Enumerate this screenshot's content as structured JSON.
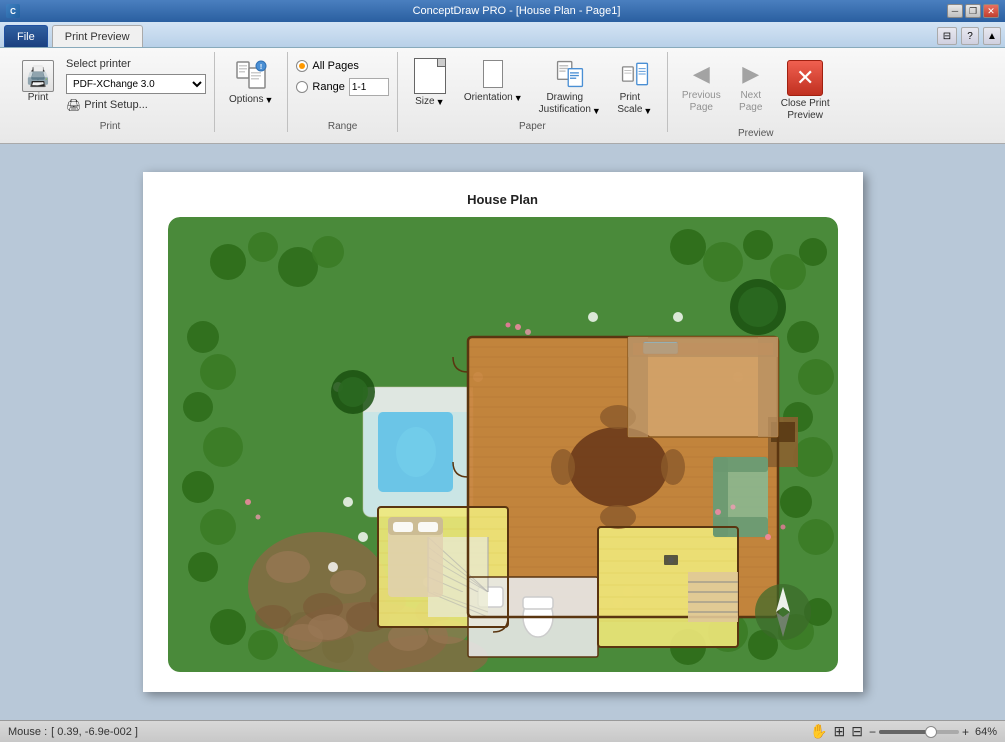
{
  "titlebar": {
    "title": "ConceptDraw PRO - [House Plan - Page1]",
    "controls": [
      "minimize",
      "restore",
      "close"
    ]
  },
  "tabs": {
    "file": "File",
    "print_preview": "Print Preview"
  },
  "ribbon": {
    "print_group": {
      "label": "Print",
      "print_btn": "Print",
      "printer_label": "Select printer",
      "printer_value": "PDF-XChange 3.0",
      "setup_label": "Print Setup..."
    },
    "options_group": {
      "options_label": "Options"
    },
    "range_group": {
      "label": "Range",
      "all_pages": "All Pages",
      "range": "Range",
      "range_value": "1-1"
    },
    "paper_group": {
      "label": "Paper",
      "size_label": "Size",
      "orientation_label": "Orientation",
      "justification_label": "Drawing\nJustification",
      "scale_label": "Print\nScale"
    },
    "preview_group": {
      "label": "Preview",
      "prev_page_label": "Previous\nPage",
      "next_page_label": "Next\nPage",
      "close_label": "Close Print\nPreview"
    }
  },
  "page": {
    "title": "House Plan"
  },
  "statusbar": {
    "mouse_label": "Mouse :",
    "mouse_value": "[ 0.39, -6.9e-002 ]",
    "zoom_value": "64%"
  }
}
